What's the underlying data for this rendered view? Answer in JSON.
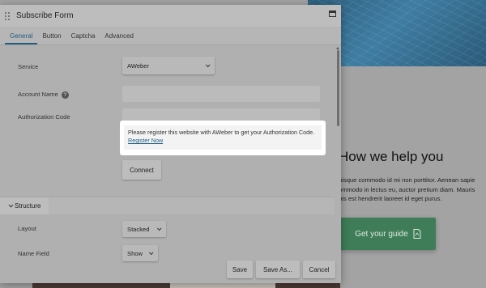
{
  "dialog": {
    "title": "Subscribe Form",
    "tabs": [
      {
        "label": "General",
        "active": true
      },
      {
        "label": "Button"
      },
      {
        "label": "Captcha"
      },
      {
        "label": "Advanced"
      }
    ]
  },
  "general": {
    "service_label": "Service",
    "service_value": "AWeber",
    "account_name_label": "Account Name",
    "account_name_value": "",
    "auth_code_label": "Authorization Code",
    "auth_code_value": "",
    "notice_text": "Please register this website with AWeber to get your Authorization Code.",
    "notice_link": "Register Now",
    "connect_label": "Connect"
  },
  "structure": {
    "section_label": "Structure",
    "layout_label": "Layout",
    "layout_value": "Stacked",
    "name_field_label": "Name Field",
    "name_field_value": "Show"
  },
  "footer": {
    "save": "Save",
    "save_as": "Save As...",
    "cancel": "Cancel"
  },
  "background": {
    "heading": "How we help you",
    "body_lines": [
      "uisque commodo id mi non porttitor. Aenean sapie",
      "ommodo in lectus eu, auctor pretium diam. Mauris",
      "uis est hendrerit laoreet id eget purus."
    ],
    "cta_label": "Get your guide"
  },
  "colors": {
    "accent": "#1f5d82",
    "cta": "#3e7d58",
    "notice_bg": "#ffffff"
  }
}
